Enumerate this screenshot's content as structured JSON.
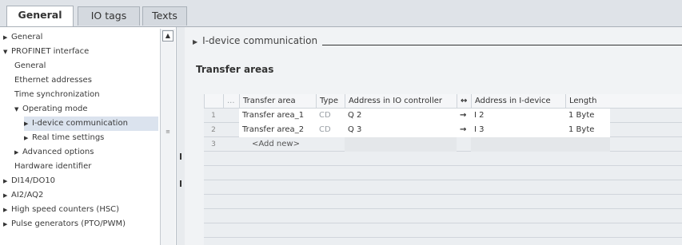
{
  "tabs": [
    "General",
    "IO tags",
    "Texts"
  ],
  "nav": {
    "items": [
      {
        "label": "General",
        "indent": 0,
        "arrow": "right"
      },
      {
        "label": "PROFINET interface",
        "indent": 0,
        "arrow": "down"
      },
      {
        "label": "General",
        "indent": 1,
        "arrow": ""
      },
      {
        "label": "Ethernet addresses",
        "indent": 1,
        "arrow": ""
      },
      {
        "label": "Time synchronization",
        "indent": 1,
        "arrow": ""
      },
      {
        "label": "Operating mode",
        "indent": 1,
        "arrow": "down"
      },
      {
        "label": "I-device communication",
        "indent": 2,
        "arrow": "right",
        "selected": true
      },
      {
        "label": "Real time settings",
        "indent": 2,
        "arrow": "right"
      },
      {
        "label": "Advanced options",
        "indent": 1,
        "arrow": "right"
      },
      {
        "label": "Hardware identifier",
        "indent": 1,
        "arrow": ""
      },
      {
        "label": "DI14/DO10",
        "indent": 0,
        "arrow": "right"
      },
      {
        "label": "AI2/AQ2",
        "indent": 0,
        "arrow": "right"
      },
      {
        "label": "High speed counters (HSC)",
        "indent": 0,
        "arrow": "right"
      },
      {
        "label": "Pulse generators (PTO/PWM)",
        "indent": 0,
        "arrow": "right"
      }
    ]
  },
  "main": {
    "section_title": "I-device communication",
    "subsection_title": "Transfer areas",
    "table": {
      "headers": [
        "...",
        "Transfer area",
        "Type",
        "Address in IO controller",
        "↔",
        "Address in I-device",
        "Length"
      ],
      "rows": [
        {
          "num": "1",
          "area": "Transfer area_1",
          "type": "CD",
          "ioc": "Q 2",
          "dir": "→",
          "idev": "I 2",
          "len": "1 Byte"
        },
        {
          "num": "2",
          "area": "Transfer area_2",
          "type": "CD",
          "ioc": "Q 3",
          "dir": "→",
          "idev": "I 3",
          "len": "1 Byte"
        }
      ],
      "add_row": {
        "num": "3",
        "label": "<Add new>"
      }
    }
  }
}
